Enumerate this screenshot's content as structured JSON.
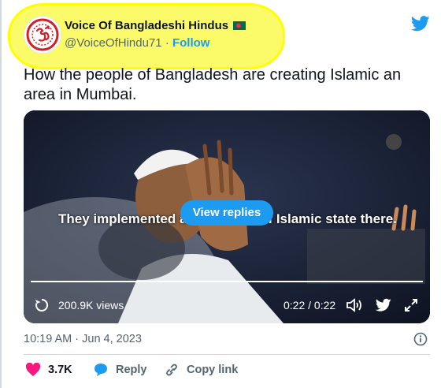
{
  "author": {
    "name": "Voice Of Bangladeshi Hindus",
    "handle": "@VoiceOfHindu71",
    "separator": "·",
    "follow_label": "Follow"
  },
  "tweet": {
    "text": "How the people of Bangladesh are creating Islamic an area in Mumbai."
  },
  "video": {
    "caption": "They implemented a small area of Islamic state there.",
    "view_replies_label": "View replies",
    "progress": 1.0,
    "views": "200.9K views",
    "time": "0:22 / 0:22"
  },
  "timestamp": "10:19 AM · Jun 4, 2023",
  "actions": {
    "likes": "3.7K",
    "reply_label": "Reply",
    "copy_link_label": "Copy link"
  },
  "colors": {
    "highlight": "#ffff00",
    "twitter_blue": "#1d9bf0",
    "like_pink": "#f91880",
    "muted_text": "#536471",
    "flag_green": "#006a4e",
    "flag_red": "#f42a41",
    "avatar_red": "#d31f26"
  },
  "icons": [
    "om-logo-icon",
    "bangladesh-flag-icon",
    "twitter-bird-icon",
    "replay-icon",
    "volume-icon",
    "expand-icon",
    "info-icon",
    "heart-icon",
    "reply-bubble-icon",
    "link-icon"
  ]
}
